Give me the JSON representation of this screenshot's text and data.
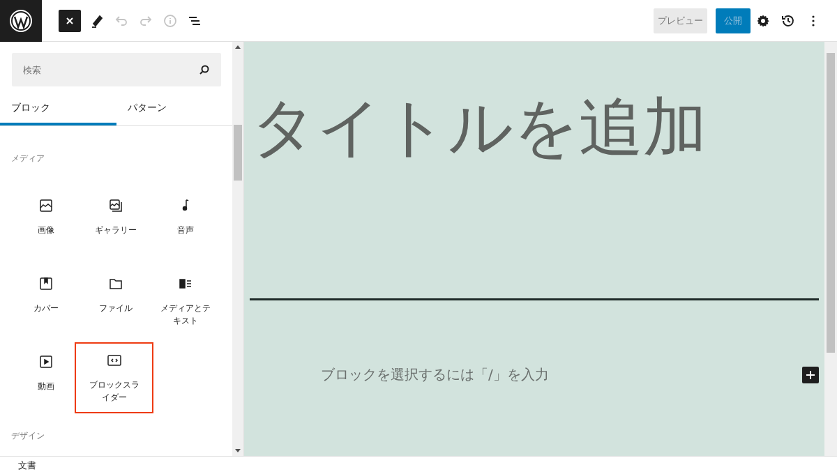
{
  "toolbar": {
    "tools": [
      {
        "kind": "close",
        "disabled": false
      },
      {
        "kind": "edit",
        "disabled": false
      },
      {
        "kind": "undo",
        "disabled": true
      },
      {
        "kind": "redo",
        "disabled": true
      },
      {
        "kind": "info",
        "disabled": true
      },
      {
        "kind": "outline",
        "disabled": false
      }
    ],
    "preview": "プレビュー",
    "publish": "公開"
  },
  "inserter": {
    "search": {
      "placeholder": "検索"
    },
    "tabs": [
      {
        "label": "ブロック",
        "selected": true
      },
      {
        "label": "パターン",
        "selected": false
      }
    ],
    "category": "メディア",
    "blocks": [
      {
        "kind": "image",
        "label": "画像",
        "highlighted": false
      },
      {
        "kind": "gallery",
        "label": "ギャラリー",
        "highlighted": false
      },
      {
        "kind": "audio",
        "label": "音声",
        "highlighted": false
      },
      {
        "kind": "cover",
        "label": "カバー",
        "highlighted": false
      },
      {
        "kind": "file",
        "label": "ファイル",
        "highlighted": false
      },
      {
        "kind": "media-text",
        "label": "メディアとテキスト",
        "highlighted": false
      },
      {
        "kind": "video",
        "label": "動画",
        "highlighted": false
      },
      {
        "kind": "slider",
        "label": "ブロックスライダー",
        "highlighted": true
      }
    ],
    "next_category": "デザイン"
  },
  "editor": {
    "title_placeholder": "タイトルを追加",
    "block_placeholder": "ブロックを選択するには「/」を入力"
  },
  "status_bar": "文書"
}
